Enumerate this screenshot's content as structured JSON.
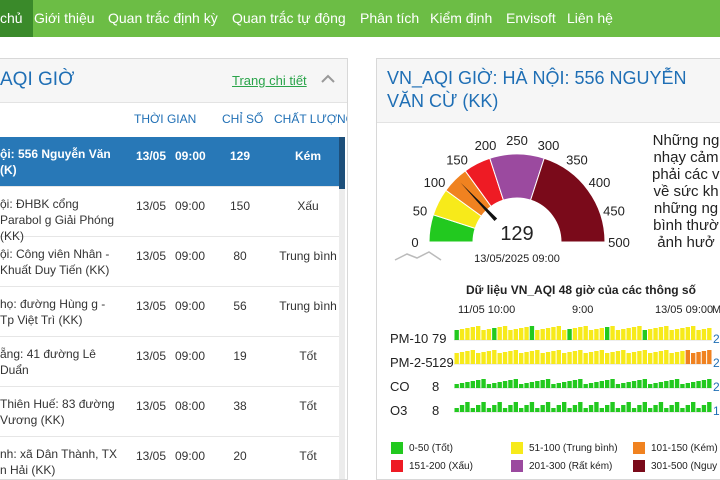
{
  "nav": {
    "items": [
      {
        "label": "chủ"
      },
      {
        "label": "Giới thiệu"
      },
      {
        "label": "Quan trắc định kỳ"
      },
      {
        "label": "Quan trắc tự động"
      },
      {
        "label": "Phân tích"
      },
      {
        "label": "Kiểm định"
      },
      {
        "label": "Envisoft"
      },
      {
        "label": "Liên hệ"
      }
    ]
  },
  "left_panel": {
    "title": "AQI GIỜ",
    "detail_link": "Trang chi tiết",
    "columns": {
      "time": "THỜI GIAN",
      "index": "CHỈ SỐ",
      "quality": "CHẤT LƯỢNG"
    },
    "rows": [
      {
        "name": "ội: 556 Nguyễn Văn (K)",
        "date": "13/05",
        "time": "09:00",
        "value": "129",
        "quality": "Kém",
        "highlight": true
      },
      {
        "name": "ội: ĐHBK cổng Parabol g Giải Phóng (KK)",
        "date": "13/05",
        "time": "09:00",
        "value": "150",
        "quality": "Xấu"
      },
      {
        "name": "ội: Công viên Nhân - Khuất Duy Tiến (KK)",
        "date": "13/05",
        "time": "09:00",
        "value": "80",
        "quality": "Trung bình"
      },
      {
        "name": "họ: đường Hùng g - Tp Việt Trì (KK)",
        "date": "13/05",
        "time": "09:00",
        "value": "56",
        "quality": "Trung bình"
      },
      {
        "name": "ẵng: 41 đường Lê Duẩn",
        "date": "13/05",
        "time": "09:00",
        "value": "19",
        "quality": "Tốt"
      },
      {
        "name": "Thiên Huế: 83 đường Vương (KK)",
        "date": "13/05",
        "time": "08:00",
        "value": "38",
        "quality": "Tốt"
      },
      {
        "name": "nh: xã Dân Thành, TX n Hải (KK)",
        "date": "13/05",
        "time": "09:00",
        "value": "20",
        "quality": "Tốt"
      }
    ]
  },
  "right_panel": {
    "title": "VN_AQI GIỜ: HÀ NỘI: 556 NGUYỄN VĂN CỪ (KK)",
    "gauge": {
      "value": "129",
      "level": 129,
      "max": 500,
      "timestamp": "13/05/2025 09:00",
      "ticks": [
        "0",
        "50",
        "100",
        "150",
        "200",
        "250",
        "300",
        "350",
        "400",
        "450",
        "500"
      ]
    },
    "advice_lines": [
      "Những ng",
      "nhạy cảm",
      "phải các vấ",
      "về sức kh",
      "những ng",
      "bình thườ",
      "ảnh hưở"
    ],
    "chart": {
      "title": "Dữ liệu VN_AQI 48 giờ của các thông số",
      "axis_labels": [
        "11/05 10:00",
        "9:00",
        "13/05 09:00",
        "M"
      ],
      "params": [
        {
          "name": "PM-10",
          "value": "79",
          "right": "2"
        },
        {
          "name": "PM-2-5",
          "value": "129",
          "right": "2"
        },
        {
          "name": "CO",
          "value": "8",
          "right": "2"
        },
        {
          "name": "O3",
          "value": "8",
          "right": "1"
        }
      ]
    },
    "legend": [
      {
        "label": "0-50 (Tốt)",
        "color": "#22c91f"
      },
      {
        "label": "51-100 (Trung bình)",
        "color": "#f7ea1a"
      },
      {
        "label": "101-150 (Kém)",
        "color": "#f08220"
      },
      {
        "label": "151-200 (Xấu)",
        "color": "#ee1b24"
      },
      {
        "label": "201-300 (Rất kém)",
        "color": "#9b4a9f"
      },
      {
        "label": "301-500 (Nguy h",
        "color": "#7a0a1a"
      }
    ]
  },
  "colors": {
    "nav_bg": "#6cbd45",
    "nav_active": "#3a8a2a",
    "accent_blue": "#1f6fb5",
    "highlight_row": "#2878b7",
    "link_green": "#2aa44a"
  }
}
